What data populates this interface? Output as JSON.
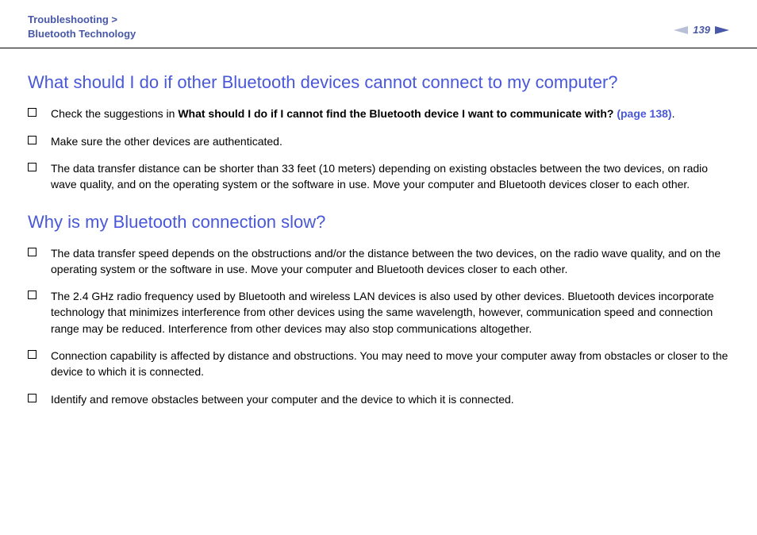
{
  "header": {
    "breadcrumb_line1": "Troubleshooting >",
    "breadcrumb_line2": "Bluetooth Technology",
    "page_number": "139"
  },
  "sections": [
    {
      "title": "What should I do if other Bluetooth devices cannot connect to my computer?",
      "items": [
        {
          "prefix": "Check the suggestions in ",
          "bold_part": "What should I do if I cannot find the Bluetooth device I want to communicate with? ",
          "link_part": "(page 138)",
          "suffix": "."
        },
        {
          "text": "Make sure the other devices are authenticated."
        },
        {
          "text": "The data transfer distance can be shorter than 33 feet (10 meters) depending on existing obstacles between the two devices, on radio wave quality, and on the operating system or the software in use. Move your computer and Bluetooth devices closer to each other."
        }
      ]
    },
    {
      "title": "Why is my Bluetooth connection slow?",
      "items": [
        {
          "text": "The data transfer speed depends on the obstructions and/or the distance between the two devices, on the radio wave quality, and on the operating system or the software in use. Move your computer and Bluetooth devices closer to each other."
        },
        {
          "text": "The 2.4 GHz radio frequency used by Bluetooth and wireless LAN devices is also used by other devices. Bluetooth devices incorporate technology that minimizes interference from other devices using the same wavelength, however, communication speed and connection range may be reduced. Interference from other devices may also stop communications altogether."
        },
        {
          "text": "Connection capability is affected by distance and obstructions. You may need to move your computer away from obstacles or closer to the device to which it is connected."
        },
        {
          "text": "Identify and remove obstacles between your computer and the device to which it is connected."
        }
      ]
    }
  ]
}
